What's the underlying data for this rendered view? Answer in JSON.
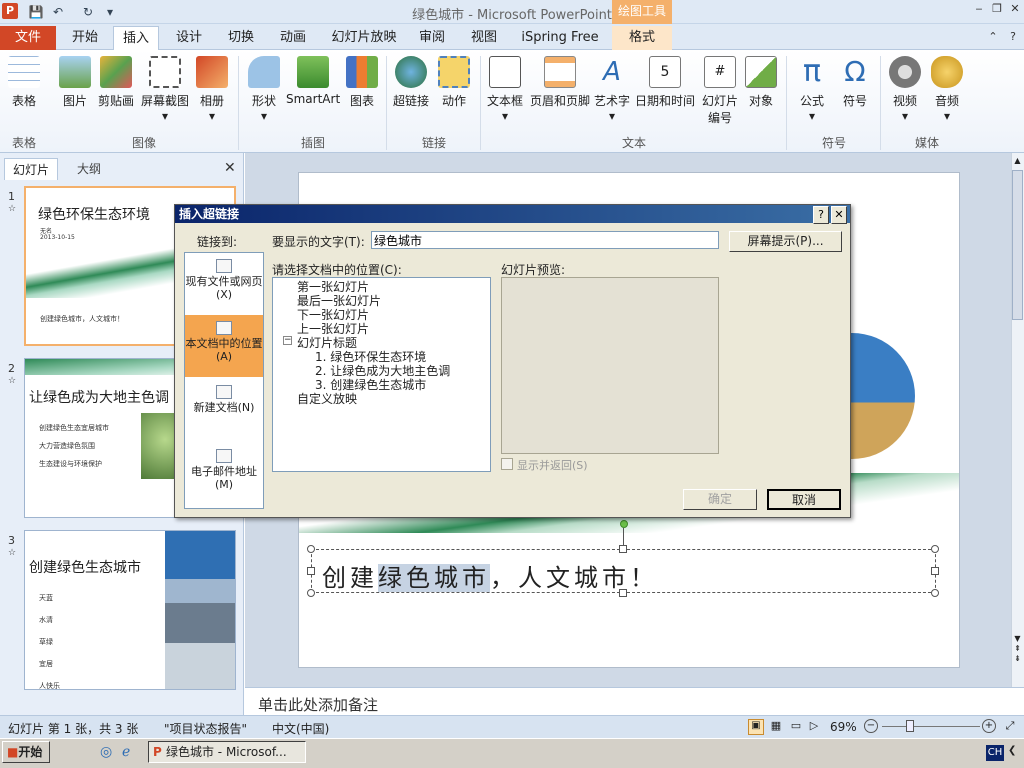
{
  "window": {
    "title": "绿色城市 - Microsoft PowerPoint",
    "contextual_tab": "绘图工具"
  },
  "tabs": {
    "file": "文件",
    "items": [
      "开始",
      "插入",
      "设计",
      "切换",
      "动画",
      "幻灯片放映",
      "审阅",
      "视图",
      "iSpring Free",
      "格式"
    ],
    "active": "插入"
  },
  "ribbon": {
    "buttons": [
      "表格",
      "图片",
      "剪贴画",
      "屏幕截图",
      "相册",
      "形状",
      "SmartArt",
      "图表",
      "超链接",
      "动作",
      "文本框",
      "页眉和页脚",
      "艺术字",
      "日期和时间",
      "幻灯片编号",
      "对象",
      "公式",
      "符号",
      "视频",
      "音频"
    ],
    "groups": [
      "表格",
      "图像",
      "插图",
      "链接",
      "文本",
      "符号",
      "媒体"
    ]
  },
  "panel": {
    "tab_slides": "幻灯片",
    "tab_outline": "大纲",
    "close": "✕"
  },
  "thumbs": [
    {
      "num": "1",
      "title": "绿色环保生态环境",
      "lines": [
        "无名",
        "2013-10-15",
        "创建绿色城市，人文城市！"
      ]
    },
    {
      "num": "2",
      "title": "让绿色成为大地主色调",
      "lines": [
        "创建绿色生态宜居城市",
        "大力营造绿色氛围",
        "生态建设与环境保护"
      ]
    },
    {
      "num": "3",
      "title": "创建绿色生态城市",
      "lines": [
        "天蓝",
        "水清",
        "草绿",
        "宜居",
        "人快乐"
      ]
    }
  ],
  "slide": {
    "text_normal_before": "创建",
    "text_selected": "绿色城市",
    "text_after": "，人文城市！"
  },
  "notes": {
    "placeholder": "单击此处添加备注"
  },
  "status": {
    "slide_info": "幻灯片 第 1 张，共 3 张",
    "theme": "\"项目状态报告\"",
    "language": "中文(中国)",
    "zoom": "69%"
  },
  "taskbar": {
    "start": "开始",
    "task": "绿色城市 - Microsof...",
    "ime": "CH"
  },
  "dialog": {
    "title": "插入超链接",
    "help": "?",
    "close": "✕",
    "link_to_label": "链接到:",
    "display_text_label": "要显示的文字(T):",
    "display_text_value": "绿色城市",
    "screen_tip": "屏幕提示(P)...",
    "link_targets": [
      {
        "label": "现有文件或网页(X)",
        "selected": false
      },
      {
        "label": "本文档中的位置(A)",
        "selected": true
      },
      {
        "label": "新建文档(N)",
        "selected": false
      },
      {
        "label": "电子邮件地址(M)",
        "selected": false
      }
    ],
    "place_label": "请选择文档中的位置(C):",
    "tree": [
      "第一张幻灯片",
      "最后一张幻灯片",
      "下一张幻灯片",
      "上一张幻灯片",
      "幻灯片标题",
      "1. 绿色环保生态环境",
      "2. 让绿色成为大地主色调",
      "3. 创建绿色生态城市",
      "自定义放映"
    ],
    "preview_label": "幻灯片预览:",
    "show_return": "显示并返回(S)",
    "ok": "确定",
    "cancel": "取消"
  },
  "colors": {
    "file_tab": "#d24726",
    "selection": "#f4a54f",
    "dialog_title": "#0a246a"
  }
}
